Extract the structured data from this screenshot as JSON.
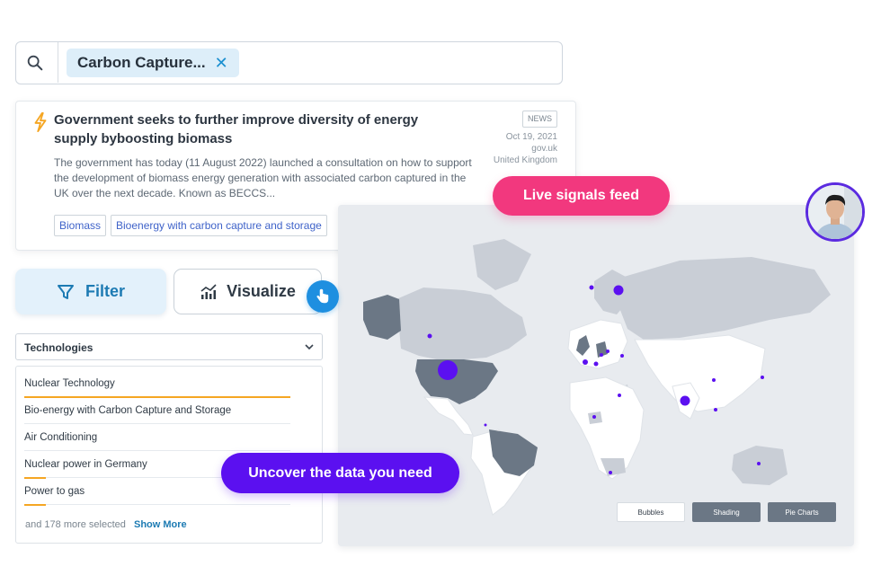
{
  "search": {
    "chip_label": "Carbon Capture...",
    "icons": {
      "search": "search-icon",
      "remove": "close-icon"
    }
  },
  "news": {
    "title": "Government seeks to further improve diversity  of energy supply byboosting biomass",
    "description": "The government has today (11 August 2022) launched a consultation on how to support the development of biomass energy generation with associated carbon captured in the UK over the next decade. Known as BECCS...",
    "badge": "NEWS",
    "date": "Oct 19, 2021",
    "source": "gov.uk",
    "country": "United Kingdom",
    "tags": [
      "Biomass",
      "Bioenergy with carbon capture and storage"
    ],
    "icon": "bolt-icon"
  },
  "callouts": {
    "live_signals": "Live signals feed",
    "uncover": "Uncover the data you need"
  },
  "buttons": {
    "filter": "Filter",
    "visualize": "Visualize"
  },
  "dropdown": {
    "label": "Technologies"
  },
  "technologies": [
    {
      "label": "Nuclear Technology",
      "weight": 1.0
    },
    {
      "label": "Bio-energy with Carbon Capture and Storage",
      "weight": 0.0
    },
    {
      "label": "Air Conditioning",
      "weight": 0.0
    },
    {
      "label": "Nuclear power in Germany",
      "weight": 0.08
    },
    {
      "label": "Power to gas",
      "weight": 0.08
    }
  ],
  "more_selected": "and 178 more selected",
  "show_more": "Show More",
  "map_tabs": [
    "Bubbles",
    "Shading",
    "Pie Charts"
  ],
  "colors": {
    "accent_blue": "#1d7bb3",
    "pink": "#f2387e",
    "purple": "#5b10f0",
    "bubble": "#5b10f0",
    "land": "#c9ced6",
    "land_dark": "#6b7785",
    "highlight": "#f5a623"
  }
}
